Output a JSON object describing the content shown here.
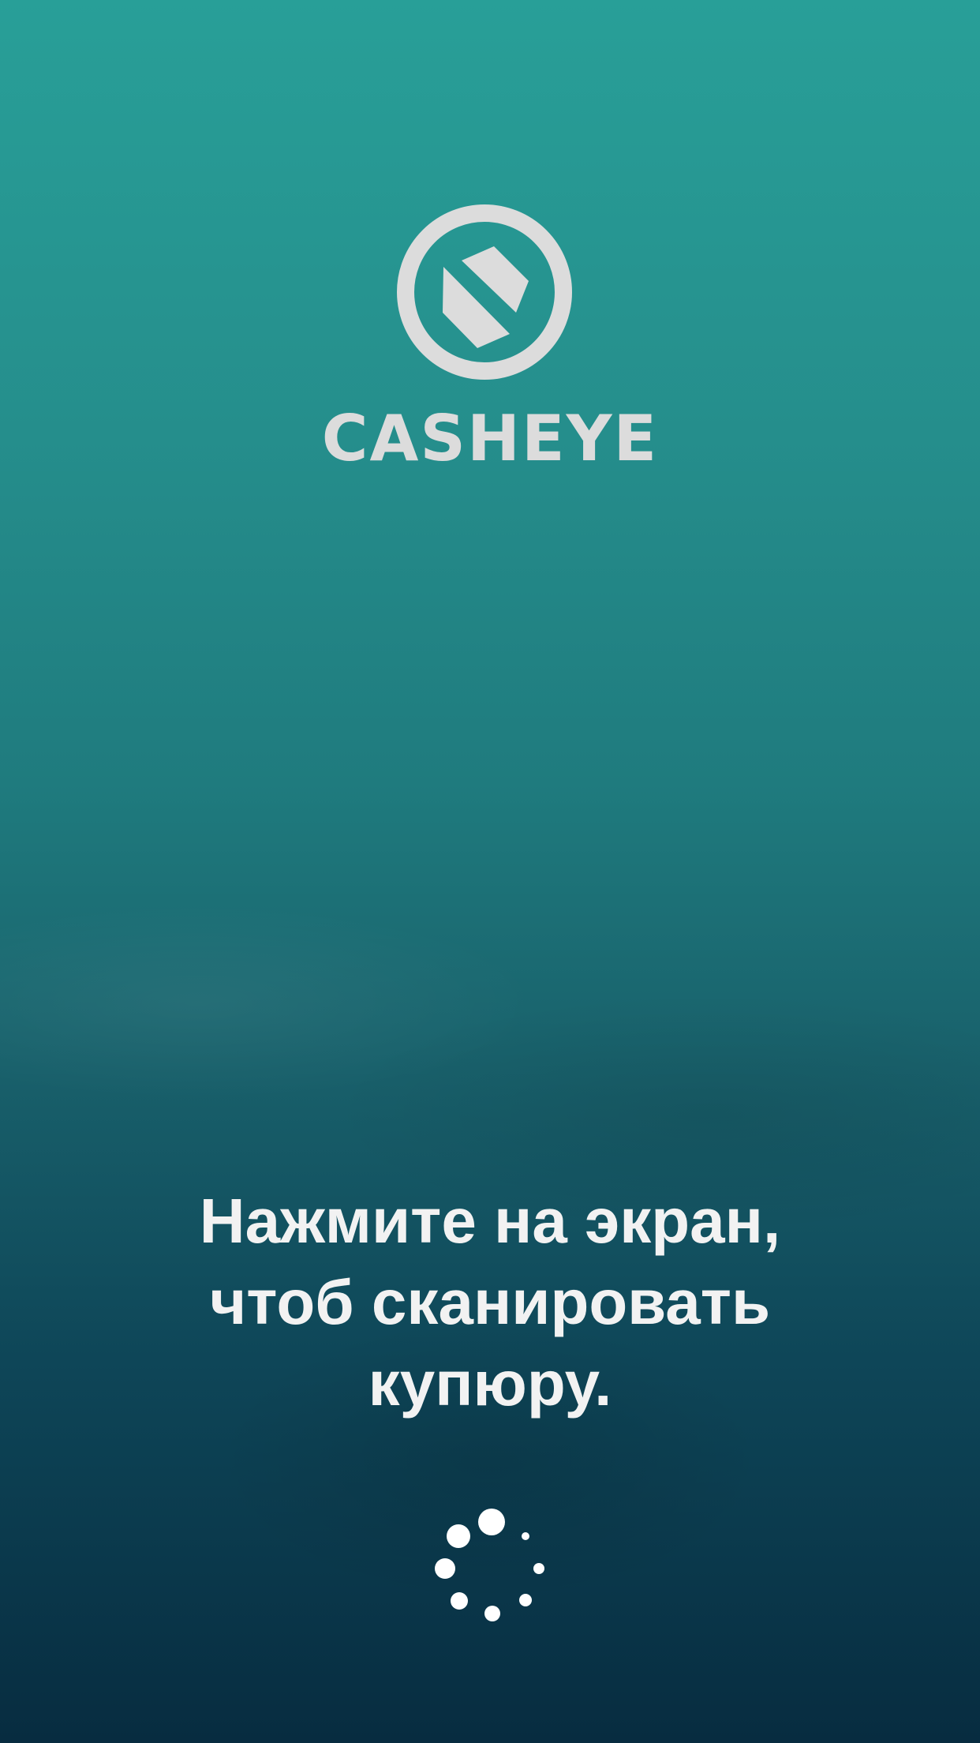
{
  "app": {
    "brand_name": "CASHEYE",
    "logo_icon": "banknote-eye-logo-icon"
  },
  "prompt": {
    "lines": [
      "Нажмите на экран,",
      "чтоб сканировать",
      "купюру."
    ]
  },
  "spinner": {
    "icon": "loading-spinner-icon"
  },
  "colors": {
    "background_top": "#289f98",
    "background_bottom": "#072c40",
    "logo": "#dcdcdc",
    "text": "#f2f2f2",
    "spinner": "#ffffff"
  }
}
